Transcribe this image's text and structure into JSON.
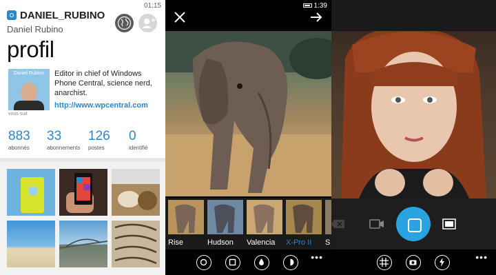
{
  "profile_screen": {
    "status_time": "01:15",
    "username": "DANIEL_RUBINO",
    "full_name": "Daniel Rubino",
    "page_title": "profil",
    "avatar_label": "Daniel Rubino",
    "follows_you": "vous suit",
    "bio": "Editor in chief of Windows Phone Central, science nerd, anarchist.",
    "website": "http://www.wpcentral.com",
    "stats": [
      {
        "value": "883",
        "label": "abonnés"
      },
      {
        "value": "33",
        "label": "abonnements"
      },
      {
        "value": "126",
        "label": "postes"
      },
      {
        "value": "0",
        "label": "identifié"
      }
    ],
    "accent_color": "#2b87c7",
    "icons": [
      "instagram-logo-icon",
      "globe-icon",
      "add-user-icon"
    ]
  },
  "filter_screen": {
    "status_time": "1:39",
    "icons": [
      "close-icon",
      "arrow-right-icon"
    ],
    "filters": [
      {
        "label": "Rise"
      },
      {
        "label": "Hudson"
      },
      {
        "label": "Valencia"
      },
      {
        "label": "X-Pro II",
        "active": true
      },
      {
        "label": "S"
      }
    ],
    "toolbar_icons": [
      "rotate-icon",
      "frame-icon",
      "drop-icon",
      "lux-icon",
      "more-icon"
    ]
  },
  "camera_screen": {
    "icons": [
      "delete-icon",
      "video-icon",
      "shutter-icon",
      "gallery-icon"
    ],
    "toolbar_icons": [
      "grid-icon",
      "flip-camera-icon",
      "flash-icon",
      "more-icon"
    ],
    "shutter_color": "#2ba3e2"
  }
}
